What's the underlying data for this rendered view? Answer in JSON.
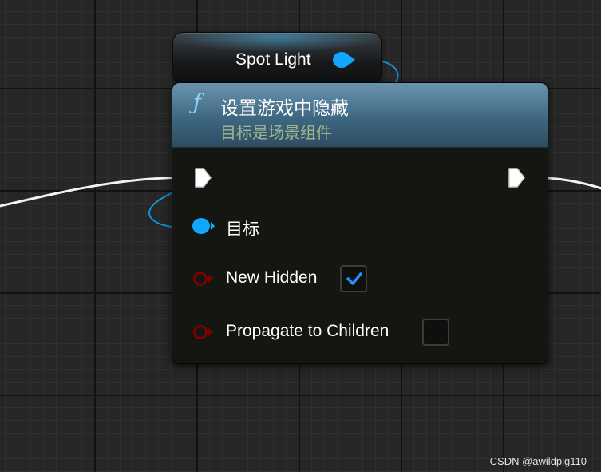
{
  "variable_node": {
    "label": "Spot Light",
    "pin_color": "#12a7ff"
  },
  "function_node": {
    "icon": "function-icon",
    "title": "设置游戏中隐藏",
    "subtitle": "目标是场景组件",
    "header_color": "#4f7a94",
    "pins": {
      "target_label": "目标",
      "new_hidden_label": "New Hidden",
      "new_hidden_checked": true,
      "propagate_label": "Propagate to Children",
      "propagate_checked": false
    }
  },
  "colors": {
    "object_pin": "#12a7ff",
    "bool_pin": "#7e0000",
    "exec_pin": "#ffffff",
    "checkmark": "#1e90ff"
  },
  "watermark": "CSDN @awildpig110"
}
